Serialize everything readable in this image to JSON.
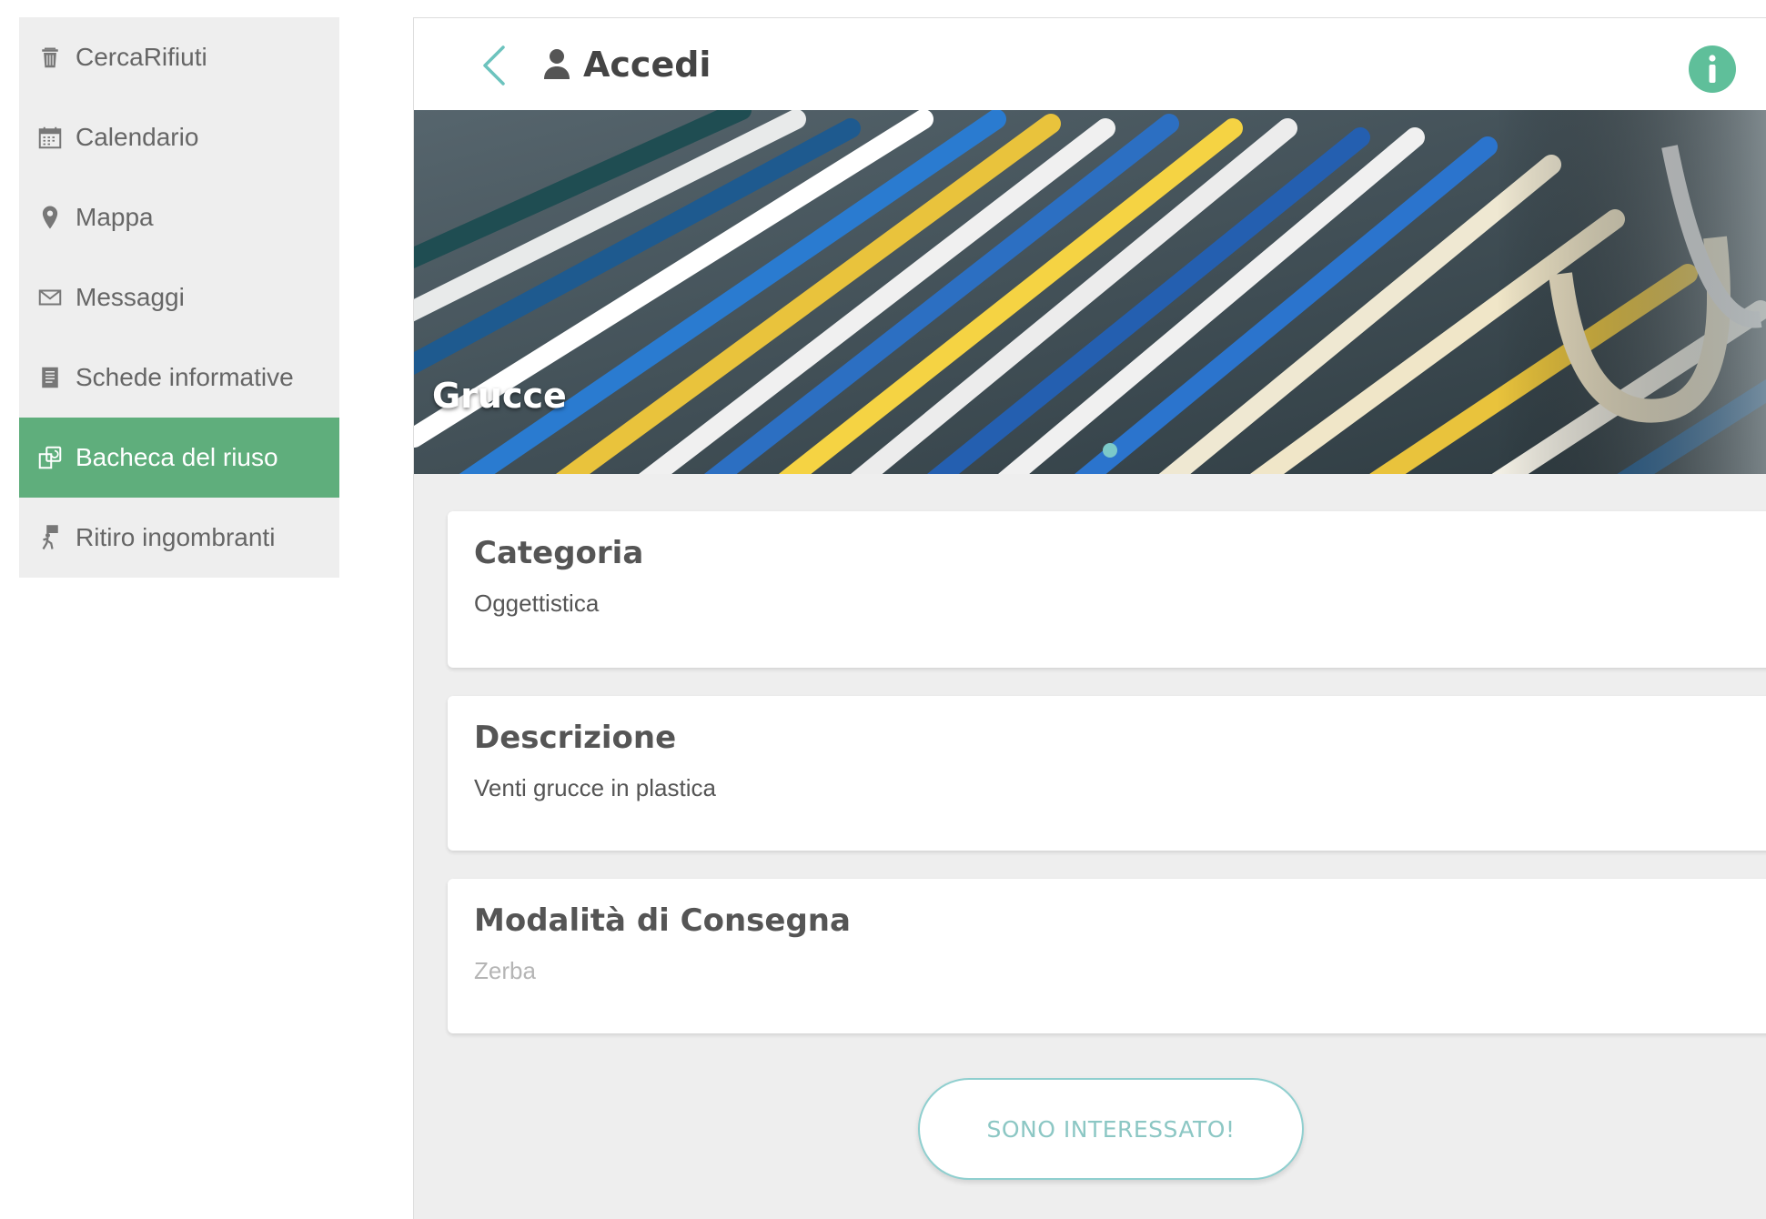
{
  "colors": {
    "accent_green": "#5fae7c",
    "teal": "#7cc9c9",
    "panel_bg": "#eeeeee",
    "card_bg": "#ffffff"
  },
  "sidebar": {
    "items": [
      {
        "label": "CercaRifiuti",
        "icon": "trash-icon",
        "active": false
      },
      {
        "label": "Calendario",
        "icon": "calendar-icon",
        "active": false
      },
      {
        "label": "Mappa",
        "icon": "map-pin-icon",
        "active": false
      },
      {
        "label": "Messaggi",
        "icon": "envelope-icon",
        "active": false
      },
      {
        "label": "Schede informative",
        "icon": "document-icon",
        "active": false
      },
      {
        "label": "Bacheca del riuso",
        "icon": "reuse-board-icon",
        "active": true
      },
      {
        "label": "Ritiro ingombranti",
        "icon": "bulky-pickup-icon",
        "active": false
      }
    ]
  },
  "header": {
    "login_label": "Accedi",
    "back_icon": "chevron-left-icon",
    "user_icon": "user-icon",
    "info_icon": "info-icon"
  },
  "hero": {
    "title": "Grucce",
    "image": "colorful plastic hangers photo",
    "slide_count": 1,
    "active_slide": 1
  },
  "sections": [
    {
      "title": "Categoria",
      "value": "Oggettistica"
    },
    {
      "title": "Descrizione",
      "value": "Venti grucce in plastica"
    },
    {
      "title": "Modalità di Consegna",
      "value": "Zerba"
    }
  ],
  "cta": {
    "label": "SONO INTERESSATO!"
  }
}
